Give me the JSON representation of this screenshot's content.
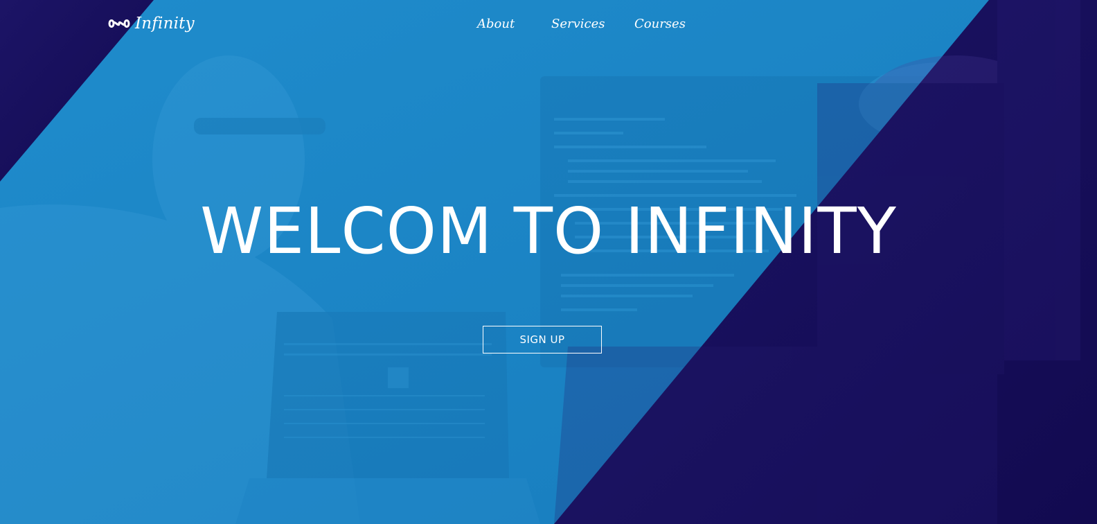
{
  "brand": {
    "icon": "infinity-icon",
    "label": "Infinity"
  },
  "nav": {
    "items": [
      {
        "label": "About"
      },
      {
        "label": "Services"
      },
      {
        "label": "Courses"
      }
    ]
  },
  "hero": {
    "title": "WELCOM TO INFINITY",
    "cta_label": "SIGN UP",
    "background_description_icon": "developer-at-laptop-photo"
  },
  "colors": {
    "accent_blue": "#1a84c4",
    "dark_navy": "#140c55",
    "text": "#ffffff"
  }
}
